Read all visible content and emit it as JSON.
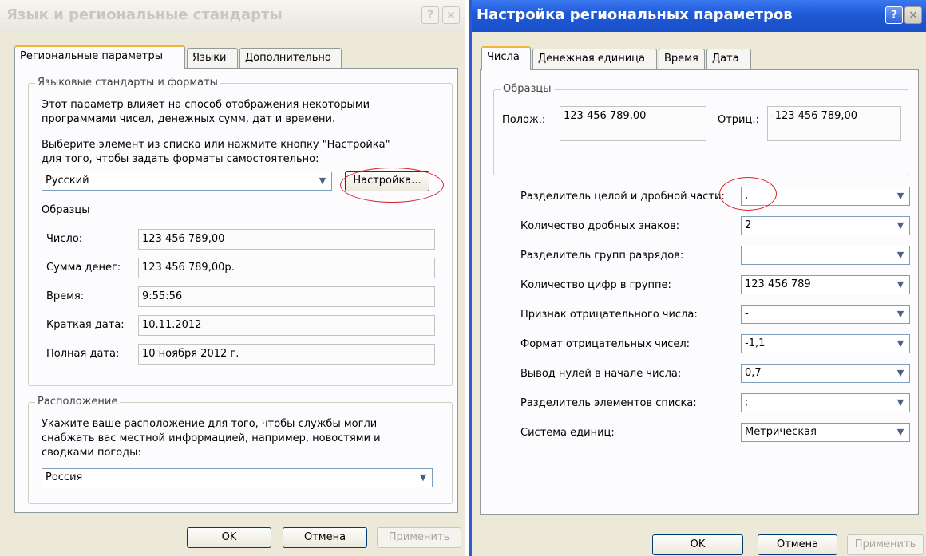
{
  "left_dialog": {
    "title": "Язык и региональные стандарты",
    "help_btn": "?",
    "close_btn": "×",
    "tabs": [
      "Региональные параметры",
      "Языки",
      "Дополнительно"
    ],
    "group_formats": {
      "legend": "Языковые стандарты и форматы",
      "desc_line1": "Этот параметр влияет на способ отображения некоторыми",
      "desc_line2": "программами чисел, денежных сумм, дат и времени.",
      "choose_line1": "Выберите элемент из списка или нажмите кнопку \"Настройка\"",
      "choose_line2": "для того, чтобы задать форматы самостоятельно:",
      "locale_value": "Русский",
      "customize_btn": "Настройка...",
      "samples_label": "Образцы",
      "samples": [
        {
          "label": "Число:",
          "value": "123 456 789,00"
        },
        {
          "label": "Сумма денег:",
          "value": "123 456 789,00р."
        },
        {
          "label": "Время:",
          "value": "9:55:56"
        },
        {
          "label": "Краткая дата:",
          "value": "10.11.2012"
        },
        {
          "label": "Полная дата:",
          "value": "10 ноября 2012 г."
        }
      ]
    },
    "group_location": {
      "legend": "Расположение",
      "desc_line1": "Укажите ваше расположение для того, чтобы службы могли",
      "desc_line2": "снабжать вас местной информацией, например, новостями и",
      "desc_line3": "сводками погоды:",
      "location_value": "Россия"
    },
    "ok_btn": "OK",
    "cancel_btn": "Отмена",
    "apply_btn": "Применить"
  },
  "right_dialog": {
    "title": "Настройка региональных параметров",
    "help_btn": "?",
    "close_btn": "×",
    "tabs": [
      "Числа",
      "Денежная единица",
      "Время",
      "Дата"
    ],
    "samples_legend": "Образцы",
    "positive_label": "Полож.:",
    "positive_value": "123 456 789,00",
    "negative_label": "Отриц.:",
    "negative_value": "-123 456 789,00",
    "settings": [
      {
        "label": "Разделитель целой и дробной части:",
        "value": ","
      },
      {
        "label": "Количество дробных знаков:",
        "value": "2"
      },
      {
        "label": "Разделитель групп разрядов:",
        "value": ""
      },
      {
        "label": "Количество цифр в группе:",
        "value": "123 456 789"
      },
      {
        "label": "Признак отрицательного числа:",
        "value": "-"
      },
      {
        "label": "Формат отрицательных чисел:",
        "value": "-1,1"
      },
      {
        "label": "Вывод нулей в начале числа:",
        "value": "0,7"
      },
      {
        "label": "Разделитель элементов списка:",
        "value": ";"
      },
      {
        "label": "Система единиц:",
        "value": "Метрическая"
      }
    ],
    "ok_btn": "OK",
    "cancel_btn": "Отмена",
    "apply_btn": "Применить"
  }
}
